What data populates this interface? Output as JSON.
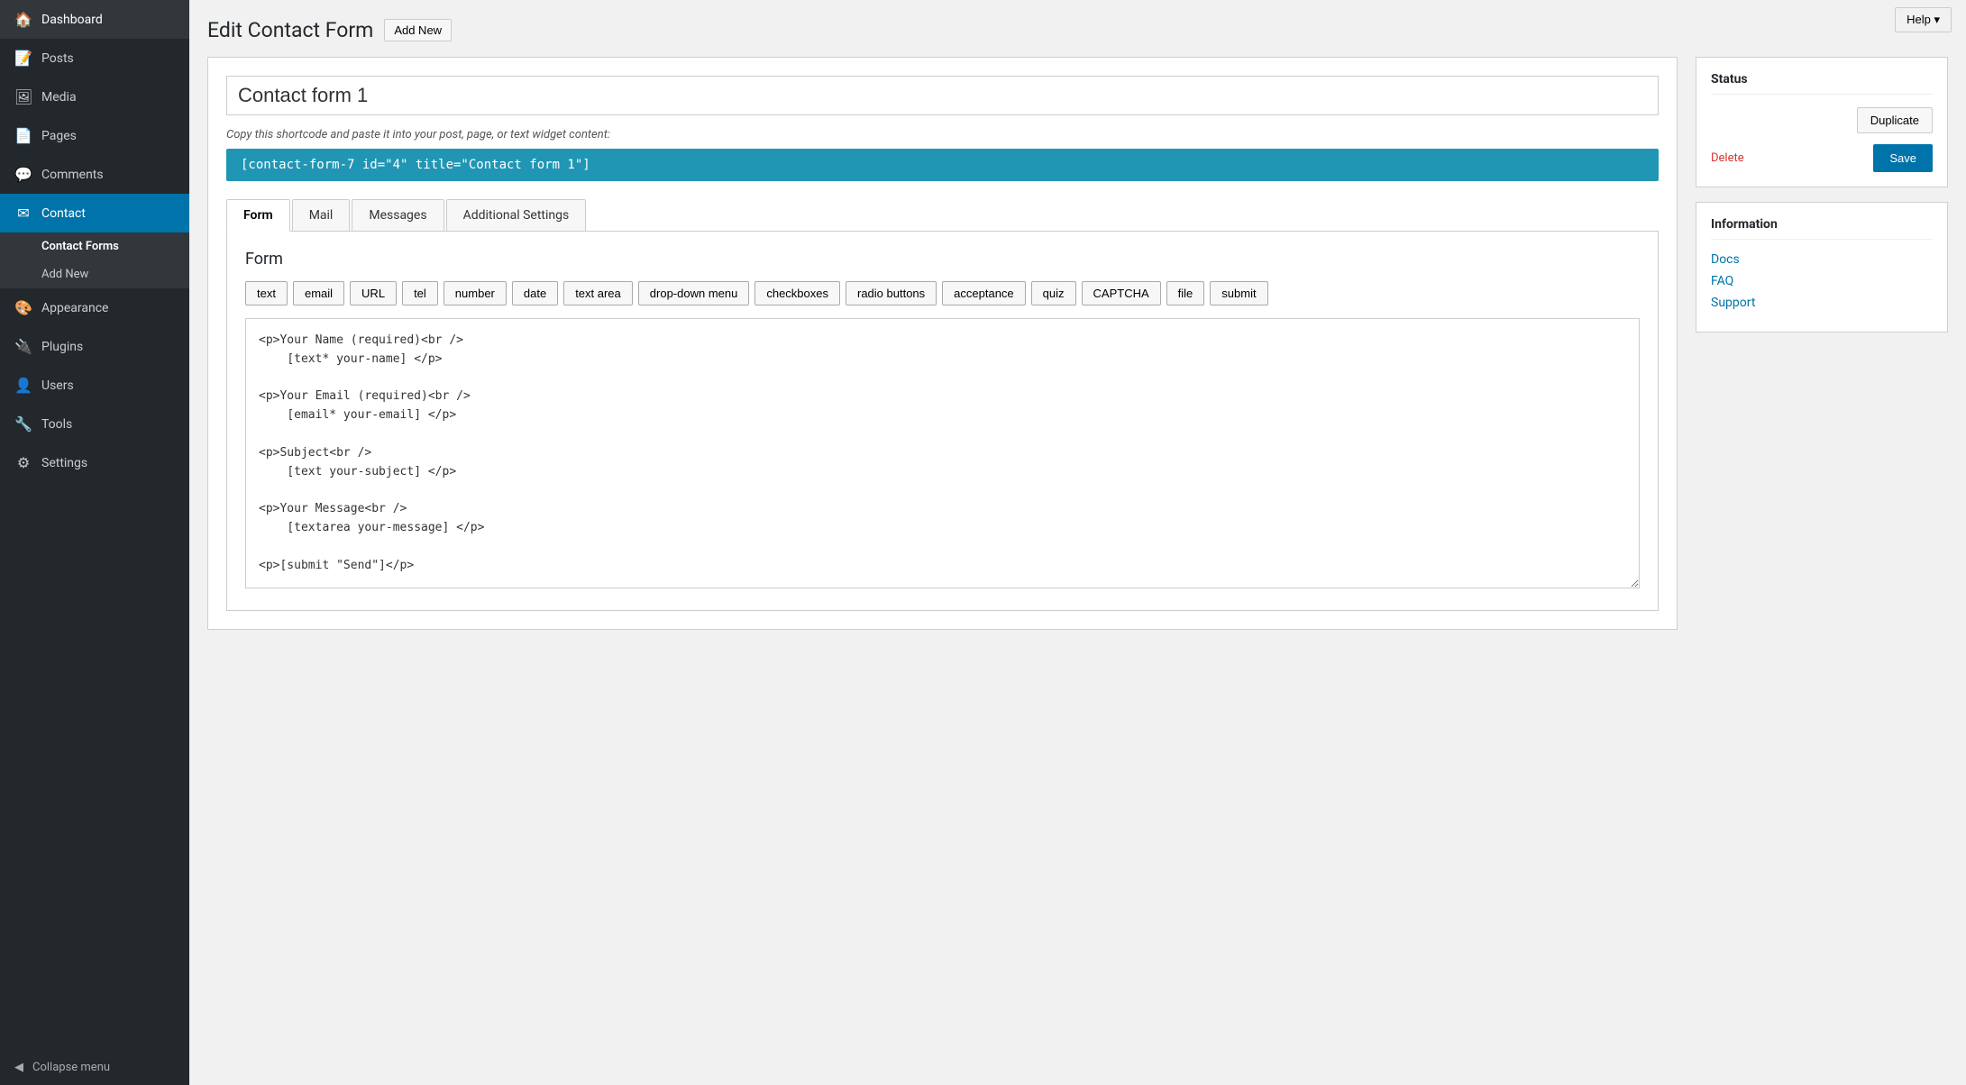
{
  "topbar": {
    "help_label": "Help ▾"
  },
  "sidebar": {
    "items": [
      {
        "id": "dashboard",
        "label": "Dashboard",
        "icon": "🏠"
      },
      {
        "id": "posts",
        "label": "Posts",
        "icon": "📝"
      },
      {
        "id": "media",
        "label": "Media",
        "icon": "🖼"
      },
      {
        "id": "pages",
        "label": "Pages",
        "icon": "📄"
      },
      {
        "id": "comments",
        "label": "Comments",
        "icon": "💬"
      },
      {
        "id": "contact",
        "label": "Contact",
        "icon": "✉",
        "active": true
      }
    ],
    "contact_sub": [
      {
        "id": "contact-forms",
        "label": "Contact Forms",
        "active": true
      },
      {
        "id": "add-new",
        "label": "Add New"
      }
    ],
    "bottom_items": [
      {
        "id": "appearance",
        "label": "Appearance",
        "icon": "🎨"
      },
      {
        "id": "plugins",
        "label": "Plugins",
        "icon": "🔌"
      },
      {
        "id": "users",
        "label": "Users",
        "icon": "👤"
      },
      {
        "id": "tools",
        "label": "Tools",
        "icon": "🔧"
      },
      {
        "id": "settings",
        "label": "Settings",
        "icon": "⚙"
      }
    ],
    "collapse_label": "Collapse menu"
  },
  "page": {
    "title": "Edit Contact Form",
    "add_new_label": "Add New"
  },
  "form": {
    "title_value": "Contact form 1",
    "shortcode_hint": "Copy this shortcode and paste it into your post, page, or text widget content:",
    "shortcode_value": "[contact-form-7 id=\"4\" title=\"Contact form 1\"]",
    "tabs": [
      {
        "id": "form",
        "label": "Form",
        "active": true
      },
      {
        "id": "mail",
        "label": "Mail"
      },
      {
        "id": "messages",
        "label": "Messages"
      },
      {
        "id": "additional",
        "label": "Additional Settings"
      }
    ],
    "form_section_title": "Form",
    "field_buttons": [
      "text",
      "email",
      "URL",
      "tel",
      "number",
      "date",
      "text area",
      "drop-down menu",
      "checkboxes",
      "radio buttons",
      "acceptance",
      "quiz",
      "CAPTCHA",
      "file",
      "submit"
    ],
    "code_content": "<p>Your Name (required)<br />\n    [text* your-name] </p>\n\n<p>Your Email (required)<br />\n    [email* your-email] </p>\n\n<p>Subject<br />\n    [text your-subject] </p>\n\n<p>Your Message<br />\n    [textarea your-message] </p>\n\n<p>[submit \"Send\"]</p>"
  },
  "status_panel": {
    "title": "Status",
    "duplicate_label": "Duplicate",
    "delete_label": "Delete",
    "save_label": "Save"
  },
  "info_panel": {
    "title": "Information",
    "links": [
      {
        "id": "docs",
        "label": "Docs"
      },
      {
        "id": "faq",
        "label": "FAQ"
      },
      {
        "id": "support",
        "label": "Support"
      }
    ]
  }
}
